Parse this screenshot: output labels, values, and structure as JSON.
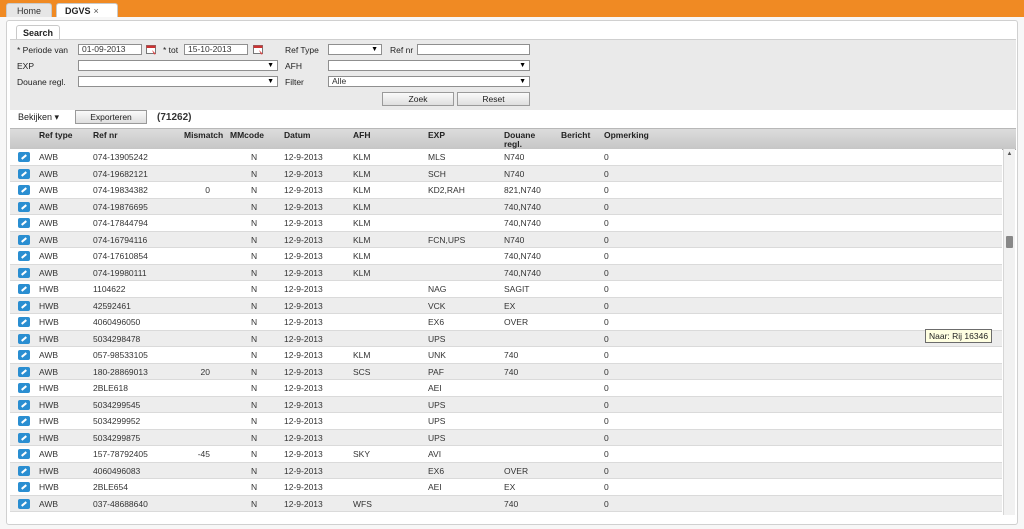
{
  "tabs": [
    {
      "label": "Home"
    },
    {
      "label": "DGVS",
      "close": "×"
    }
  ],
  "search_tab": "Search",
  "form": {
    "periode_label": "* Periode van",
    "periode_van": "01-09-2013",
    "tot_label": "* tot",
    "tot": "15-10-2013",
    "reftype_label": "Ref Type",
    "reftype_value": "",
    "refnr_label": "Ref nr",
    "refnr_value": "",
    "exp_label": "EXP",
    "exp_value": "",
    "afh_label": "AFH",
    "afh_value": "",
    "douane_label": "Douane regl.",
    "douane_value": "",
    "filter_label": "Filter",
    "filter_value": "Alle",
    "zoek": "Zoek",
    "reset": "Reset"
  },
  "toolbar": {
    "bekijken": "Bekijken ▾",
    "exporteren": "Exporteren",
    "count": "(71262)"
  },
  "columns": [
    "Ref type",
    "Ref nr",
    "Mismatch",
    "MMcode",
    "Datum",
    "AFH",
    "EXP",
    "Douane regl.",
    "Bericht",
    "Opmerking"
  ],
  "rows": [
    {
      "type": "AWB",
      "refnr": "074-13905242",
      "mismatch": "",
      "mmcode": "N",
      "datum": "12-9-2013",
      "afh": "KLM",
      "exp": "MLS",
      "douane": "N740",
      "bericht": "0"
    },
    {
      "type": "AWB",
      "refnr": "074-19682121",
      "mismatch": "",
      "mmcode": "N",
      "datum": "12-9-2013",
      "afh": "KLM",
      "exp": "SCH",
      "douane": "N740",
      "bericht": "0"
    },
    {
      "type": "AWB",
      "refnr": "074-19834382",
      "mismatch": "0",
      "mmcode": "N",
      "datum": "12-9-2013",
      "afh": "KLM",
      "exp": "KD2,RAH",
      "douane": "821,N740",
      "bericht": "0"
    },
    {
      "type": "AWB",
      "refnr": "074-19876695",
      "mismatch": "",
      "mmcode": "N",
      "datum": "12-9-2013",
      "afh": "KLM",
      "exp": "",
      "douane": "740,N740",
      "bericht": "0"
    },
    {
      "type": "AWB",
      "refnr": "074-17844794",
      "mismatch": "",
      "mmcode": "N",
      "datum": "12-9-2013",
      "afh": "KLM",
      "exp": "",
      "douane": "740,N740",
      "bericht": "0"
    },
    {
      "type": "AWB",
      "refnr": "074-16794116",
      "mismatch": "",
      "mmcode": "N",
      "datum": "12-9-2013",
      "afh": "KLM",
      "exp": "FCN,UPS",
      "douane": "N740",
      "bericht": "0"
    },
    {
      "type": "AWB",
      "refnr": "074-17610854",
      "mismatch": "",
      "mmcode": "N",
      "datum": "12-9-2013",
      "afh": "KLM",
      "exp": "",
      "douane": "740,N740",
      "bericht": "0"
    },
    {
      "type": "AWB",
      "refnr": "074-19980111",
      "mismatch": "",
      "mmcode": "N",
      "datum": "12-9-2013",
      "afh": "KLM",
      "exp": "",
      "douane": "740,N740",
      "bericht": "0"
    },
    {
      "type": "HWB",
      "refnr": "1104622",
      "mismatch": "",
      "mmcode": "N",
      "datum": "12-9-2013",
      "afh": "",
      "exp": "NAG",
      "douane": "SAGIT",
      "bericht": "0"
    },
    {
      "type": "HWB",
      "refnr": "42592461",
      "mismatch": "",
      "mmcode": "N",
      "datum": "12-9-2013",
      "afh": "",
      "exp": "VCK",
      "douane": "EX",
      "bericht": "0"
    },
    {
      "type": "HWB",
      "refnr": "4060496050",
      "mismatch": "",
      "mmcode": "N",
      "datum": "12-9-2013",
      "afh": "",
      "exp": "EX6",
      "douane": "OVER",
      "bericht": "0"
    },
    {
      "type": "HWB",
      "refnr": "5034298478",
      "mismatch": "",
      "mmcode": "N",
      "datum": "12-9-2013",
      "afh": "",
      "exp": "UPS",
      "douane": "",
      "bericht": "0"
    },
    {
      "type": "AWB",
      "refnr": "057-98533105",
      "mismatch": "",
      "mmcode": "N",
      "datum": "12-9-2013",
      "afh": "KLM",
      "exp": "UNK",
      "douane": "740",
      "bericht": "0"
    },
    {
      "type": "AWB",
      "refnr": "180-28869013",
      "mismatch": "20",
      "mmcode": "N",
      "datum": "12-9-2013",
      "afh": "SCS",
      "exp": "PAF",
      "douane": "740",
      "bericht": "0"
    },
    {
      "type": "HWB",
      "refnr": "2BLE618",
      "mismatch": "",
      "mmcode": "N",
      "datum": "12-9-2013",
      "afh": "",
      "exp": "AEI",
      "douane": "",
      "bericht": "0"
    },
    {
      "type": "HWB",
      "refnr": "5034299545",
      "mismatch": "",
      "mmcode": "N",
      "datum": "12-9-2013",
      "afh": "",
      "exp": "UPS",
      "douane": "",
      "bericht": "0"
    },
    {
      "type": "HWB",
      "refnr": "5034299952",
      "mismatch": "",
      "mmcode": "N",
      "datum": "12-9-2013",
      "afh": "",
      "exp": "UPS",
      "douane": "",
      "bericht": "0"
    },
    {
      "type": "HWB",
      "refnr": "5034299875",
      "mismatch": "",
      "mmcode": "N",
      "datum": "12-9-2013",
      "afh": "",
      "exp": "UPS",
      "douane": "",
      "bericht": "0"
    },
    {
      "type": "AWB",
      "refnr": "157-78792405",
      "mismatch": "-45",
      "mmcode": "N",
      "datum": "12-9-2013",
      "afh": "SKY",
      "exp": "AVI",
      "douane": "",
      "bericht": "0"
    },
    {
      "type": "HWB",
      "refnr": "4060496083",
      "mismatch": "",
      "mmcode": "N",
      "datum": "12-9-2013",
      "afh": "",
      "exp": "EX6",
      "douane": "OVER",
      "bericht": "0"
    },
    {
      "type": "HWB",
      "refnr": "2BLE654",
      "mismatch": "",
      "mmcode": "N",
      "datum": "12-9-2013",
      "afh": "",
      "exp": "AEI",
      "douane": "EX",
      "bericht": "0"
    },
    {
      "type": "AWB",
      "refnr": "037-48688640",
      "mismatch": "",
      "mmcode": "N",
      "datum": "12-9-2013",
      "afh": "WFS",
      "exp": "",
      "douane": "740",
      "bericht": "0"
    }
  ],
  "tooltip": "Naar: Rij 16346",
  "colors": {
    "accent": "#f08a23",
    "row_icon": "#2a8ed1"
  },
  "icons": {
    "calendar": "calendar-icon",
    "row": "edit-record-icon",
    "dropdown": "chevron-down-icon"
  }
}
